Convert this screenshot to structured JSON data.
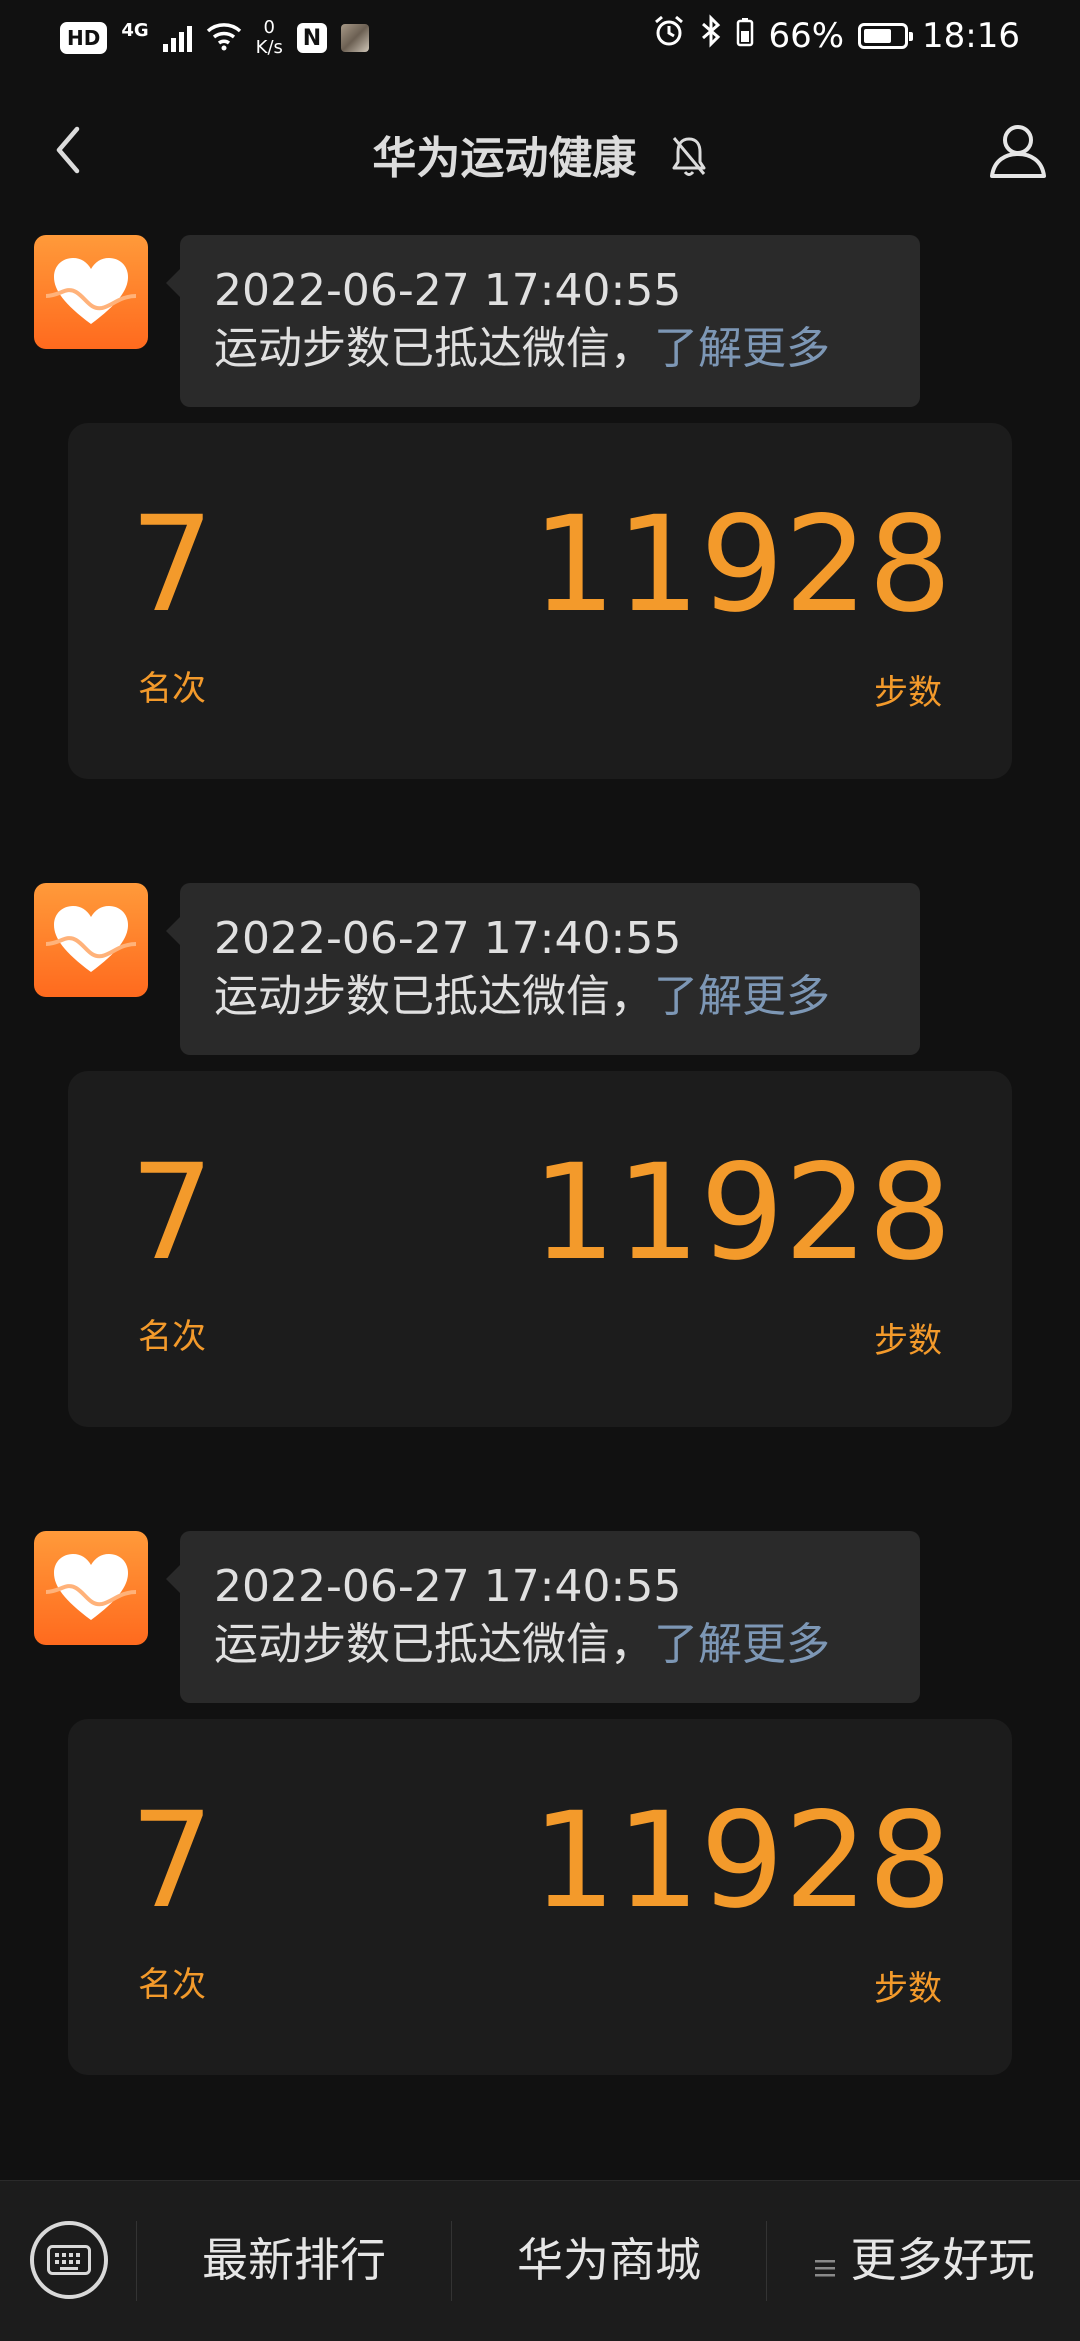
{
  "status_bar": {
    "hd": "HD",
    "network": "4G",
    "speed_value": "0",
    "speed_unit": "K/s",
    "nfc": "N",
    "battery": "66%",
    "time": "18:16"
  },
  "header": {
    "title": "华为运动健康"
  },
  "messages": [
    {
      "timestamp": "2022-06-27 17:40:55",
      "text": "运动步数已抵达微信，",
      "link": "了解更多",
      "rank": "7",
      "rank_label": "名次",
      "steps": "11928",
      "steps_label": "步数"
    },
    {
      "timestamp": "2022-06-27 17:40:55",
      "text": "运动步数已抵达微信，",
      "link": "了解更多",
      "rank": "7",
      "rank_label": "名次",
      "steps": "11928",
      "steps_label": "步数"
    },
    {
      "timestamp": "2022-06-27 17:40:55",
      "text": "运动步数已抵达微信，",
      "link": "了解更多",
      "rank": "7",
      "rank_label": "名次",
      "steps": "11928",
      "steps_label": "步数"
    }
  ],
  "bottom_menu": {
    "item1": "最新排行",
    "item2": "华为商城",
    "item3": "更多好玩"
  },
  "colors": {
    "accent": "#f39a2b",
    "link": "#7d97b5",
    "app_icon": "#ff7a24"
  }
}
